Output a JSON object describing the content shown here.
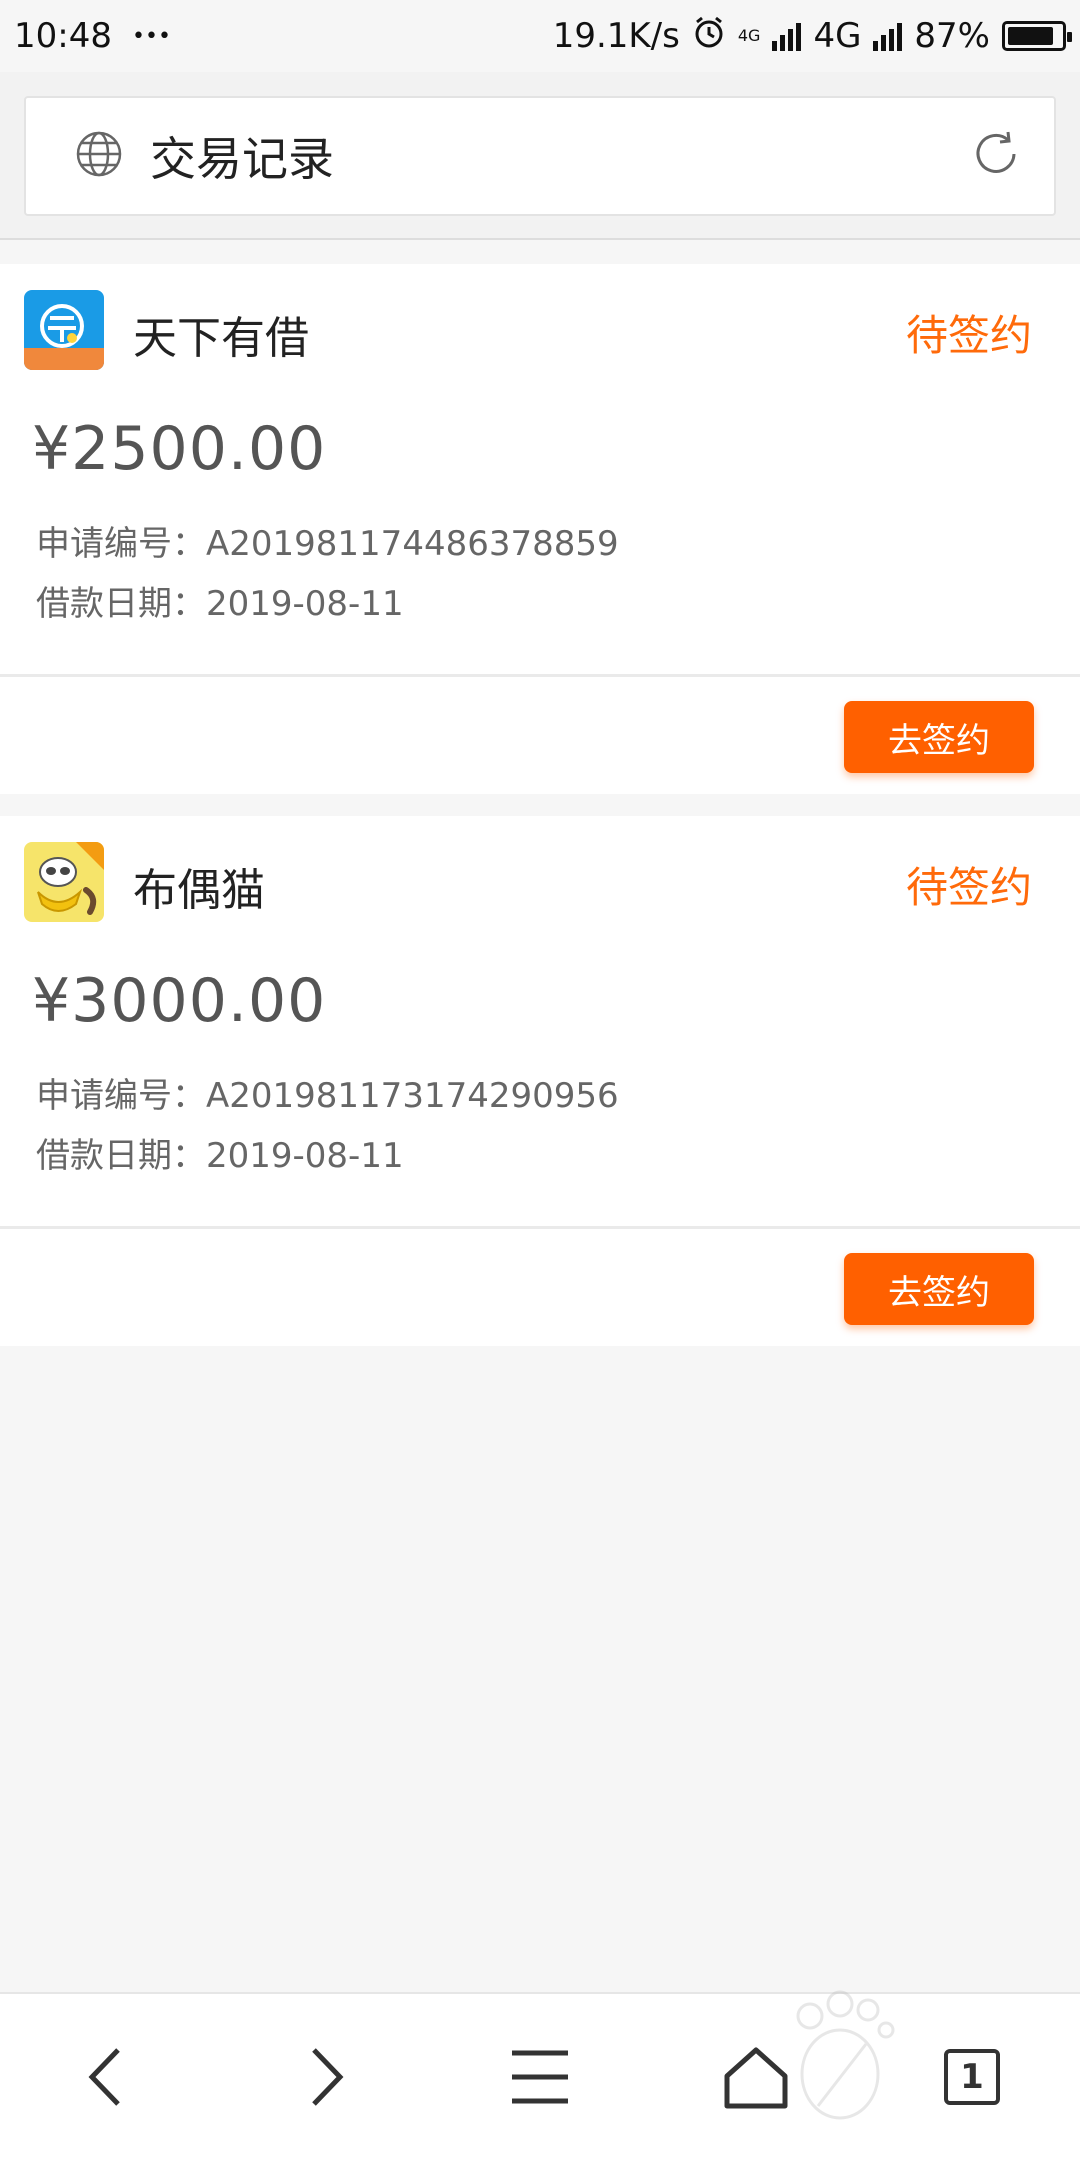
{
  "status_bar": {
    "time": "10:48",
    "dots": "•••",
    "net_speed": "19.1K/s",
    "network_small": "4G",
    "network": "4G",
    "battery_percent": "87%",
    "battery_level": 0.87
  },
  "address_bar": {
    "title": "交易记录",
    "globe_icon": "globe-icon",
    "refresh_icon": "refresh-icon"
  },
  "records": [
    {
      "lender": "天下有借",
      "status": "待签约",
      "amount": "¥2500.00",
      "app_no_label": "申请编号：",
      "app_no": "A201981174486378859",
      "date_label": "借款日期：",
      "date": "2019-08-11",
      "action": "去签约",
      "logo_text": "天下有借"
    },
    {
      "lender": "布偶猫",
      "status": "待签约",
      "amount": "¥3000.00",
      "app_no_label": "申请编号：",
      "app_no": "A201981173174290956",
      "date_label": "借款日期：",
      "date": "2019-08-11",
      "action": "去签约",
      "logo_text": "布偶猫"
    }
  ],
  "bottom_nav": {
    "tab_count": "1"
  },
  "colors": {
    "accent": "#ff6000",
    "status_text": "#ff6a0a",
    "background": "#f6f6f6"
  }
}
